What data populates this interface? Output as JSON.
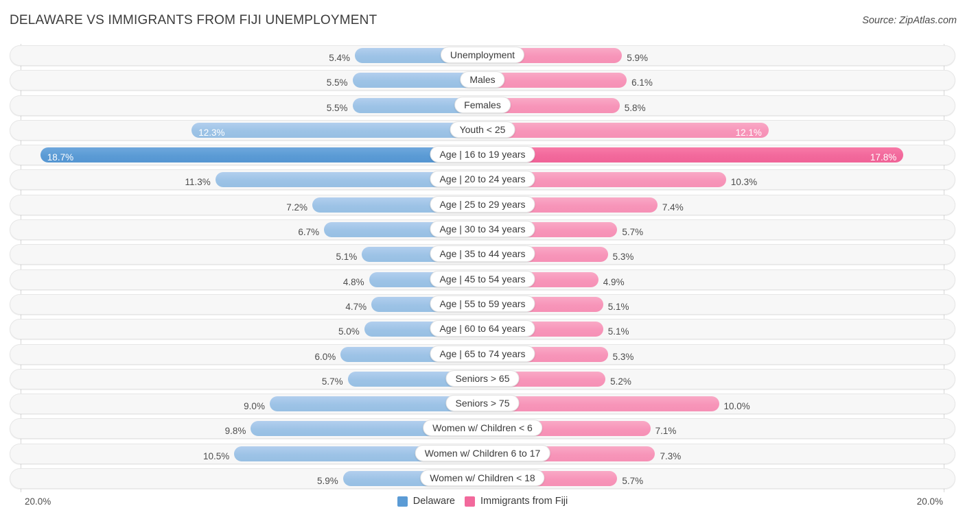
{
  "header": {
    "title": "DELAWARE VS IMMIGRANTS FROM FIJI UNEMPLOYMENT",
    "source": "Source: ZipAtlas.com"
  },
  "footer": {
    "axis_min_label": "20.0%",
    "axis_max_label": "20.0%",
    "legend": [
      {
        "label": "Delaware",
        "color": "#5b9bd5"
      },
      {
        "label": "Immigrants from Fiji",
        "color": "#f2699c"
      }
    ]
  },
  "chart_data": {
    "type": "bar",
    "title": "DELAWARE VS IMMIGRANTS FROM FIJI UNEMPLOYMENT",
    "subtitle": "",
    "orientation": "horizontal-diverging",
    "xlabel": "",
    "ylabel": "",
    "xlim": [
      0,
      20
    ],
    "axis_max": 20.0,
    "grid": false,
    "legend_position": "bottom-center",
    "categories": [
      "Unemployment",
      "Males",
      "Females",
      "Youth < 25",
      "Age | 16 to 19 years",
      "Age | 20 to 24 years",
      "Age | 25 to 29 years",
      "Age | 30 to 34 years",
      "Age | 35 to 44 years",
      "Age | 45 to 54 years",
      "Age | 55 to 59 years",
      "Age | 60 to 64 years",
      "Age | 65 to 74 years",
      "Seniors > 65",
      "Seniors > 75",
      "Women w/ Children < 6",
      "Women w/ Children 6 to 17",
      "Women w/ Children < 18"
    ],
    "series": [
      {
        "name": "Delaware",
        "color": "#9dc3e6",
        "highlight_color": "#5b9bd5",
        "values": [
          5.4,
          5.5,
          5.5,
          12.3,
          18.7,
          11.3,
          7.2,
          6.7,
          5.1,
          4.8,
          4.7,
          5.0,
          6.0,
          5.7,
          9.0,
          9.8,
          10.5,
          5.9
        ],
        "labels": [
          "5.4%",
          "5.5%",
          "5.5%",
          "12.3%",
          "18.7%",
          "11.3%",
          "7.2%",
          "6.7%",
          "5.1%",
          "4.8%",
          "4.7%",
          "5.0%",
          "6.0%",
          "5.7%",
          "9.0%",
          "9.8%",
          "10.5%",
          "5.9%"
        ]
      },
      {
        "name": "Immigrants from Fiji",
        "color": "#f795b9",
        "highlight_color": "#f2699c",
        "values": [
          5.9,
          6.1,
          5.8,
          12.1,
          17.8,
          10.3,
          7.4,
          5.7,
          5.3,
          4.9,
          5.1,
          5.1,
          5.3,
          5.2,
          10.0,
          7.1,
          7.3,
          5.7
        ],
        "labels": [
          "5.9%",
          "6.1%",
          "5.8%",
          "12.1%",
          "17.8%",
          "10.3%",
          "7.4%",
          "5.7%",
          "5.3%",
          "4.9%",
          "5.1%",
          "5.1%",
          "5.3%",
          "5.2%",
          "10.0%",
          "7.1%",
          "7.3%",
          "5.7%"
        ]
      }
    ],
    "rows": [
      {
        "label": "Unemployment",
        "left": 5.4,
        "left_label": "5.4%",
        "right": 5.9,
        "right_label": "5.9%",
        "highlight": false,
        "left_inside": false,
        "right_inside": false
      },
      {
        "label": "Males",
        "left": 5.5,
        "left_label": "5.5%",
        "right": 6.1,
        "right_label": "6.1%",
        "highlight": false,
        "left_inside": false,
        "right_inside": false
      },
      {
        "label": "Females",
        "left": 5.5,
        "left_label": "5.5%",
        "right": 5.8,
        "right_label": "5.8%",
        "highlight": false,
        "left_inside": false,
        "right_inside": false
      },
      {
        "label": "Youth < 25",
        "left": 12.3,
        "left_label": "12.3%",
        "right": 12.1,
        "right_label": "12.1%",
        "highlight": false,
        "left_inside": true,
        "right_inside": true
      },
      {
        "label": "Age | 16 to 19 years",
        "left": 18.7,
        "left_label": "18.7%",
        "right": 17.8,
        "right_label": "17.8%",
        "highlight": true,
        "left_inside": true,
        "right_inside": true
      },
      {
        "label": "Age | 20 to 24 years",
        "left": 11.3,
        "left_label": "11.3%",
        "right": 10.3,
        "right_label": "10.3%",
        "highlight": false,
        "left_inside": false,
        "right_inside": false
      },
      {
        "label": "Age | 25 to 29 years",
        "left": 7.2,
        "left_label": "7.2%",
        "right": 7.4,
        "right_label": "7.4%",
        "highlight": false,
        "left_inside": false,
        "right_inside": false
      },
      {
        "label": "Age | 30 to 34 years",
        "left": 6.7,
        "left_label": "6.7%",
        "right": 5.7,
        "right_label": "5.7%",
        "highlight": false,
        "left_inside": false,
        "right_inside": false
      },
      {
        "label": "Age | 35 to 44 years",
        "left": 5.1,
        "left_label": "5.1%",
        "right": 5.3,
        "right_label": "5.3%",
        "highlight": false,
        "left_inside": false,
        "right_inside": false
      },
      {
        "label": "Age | 45 to 54 years",
        "left": 4.8,
        "left_label": "4.8%",
        "right": 4.9,
        "right_label": "4.9%",
        "highlight": false,
        "left_inside": false,
        "right_inside": false
      },
      {
        "label": "Age | 55 to 59 years",
        "left": 4.7,
        "left_label": "4.7%",
        "right": 5.1,
        "right_label": "5.1%",
        "highlight": false,
        "left_inside": false,
        "right_inside": false
      },
      {
        "label": "Age | 60 to 64 years",
        "left": 5.0,
        "left_label": "5.0%",
        "right": 5.1,
        "right_label": "5.1%",
        "highlight": false,
        "left_inside": false,
        "right_inside": false
      },
      {
        "label": "Age | 65 to 74 years",
        "left": 6.0,
        "left_label": "6.0%",
        "right": 5.3,
        "right_label": "5.3%",
        "highlight": false,
        "left_inside": false,
        "right_inside": false
      },
      {
        "label": "Seniors > 65",
        "left": 5.7,
        "left_label": "5.7%",
        "right": 5.2,
        "right_label": "5.2%",
        "highlight": false,
        "left_inside": false,
        "right_inside": false
      },
      {
        "label": "Seniors > 75",
        "left": 9.0,
        "left_label": "9.0%",
        "right": 10.0,
        "right_label": "10.0%",
        "highlight": false,
        "left_inside": false,
        "right_inside": false
      },
      {
        "label": "Women w/ Children < 6",
        "left": 9.8,
        "left_label": "9.8%",
        "right": 7.1,
        "right_label": "7.1%",
        "highlight": false,
        "left_inside": false,
        "right_inside": false
      },
      {
        "label": "Women w/ Children 6 to 17",
        "left": 10.5,
        "left_label": "10.5%",
        "right": 7.3,
        "right_label": "7.3%",
        "highlight": false,
        "left_inside": false,
        "right_inside": false
      },
      {
        "label": "Women w/ Children < 18",
        "left": 5.9,
        "left_label": "5.9%",
        "right": 5.7,
        "right_label": "5.7%",
        "highlight": false,
        "left_inside": false,
        "right_inside": false
      }
    ]
  }
}
